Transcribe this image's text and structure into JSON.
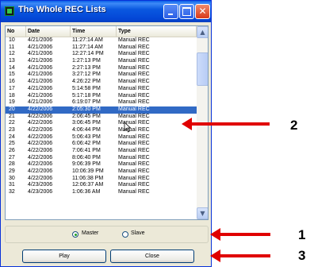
{
  "window": {
    "title": "The Whole REC Lists"
  },
  "list": {
    "headers": [
      "No",
      "Date",
      "Time",
      "Type"
    ],
    "rows": [
      [
        "10",
        "4/21/2006",
        "11:27:14 AM",
        "Manual REC"
      ],
      [
        "11",
        "4/21/2006",
        "11:27:14 AM",
        "Manual REC"
      ],
      [
        "12",
        "4/21/2006",
        "12:27:14 PM",
        "Manual REC"
      ],
      [
        "13",
        "4/21/2006",
        "1:27:13 PM",
        "Manual REC"
      ],
      [
        "14",
        "4/21/2006",
        "2:27:13 PM",
        "Manual REC"
      ],
      [
        "15",
        "4/21/2006",
        "3:27:12 PM",
        "Manual REC"
      ],
      [
        "16",
        "4/21/2006",
        "4:26:22 PM",
        "Manual REC"
      ],
      [
        "17",
        "4/21/2006",
        "5:14:58 PM",
        "Manual REC"
      ],
      [
        "18",
        "4/21/2006",
        "5:17:18 PM",
        "Manual REC"
      ],
      [
        "19",
        "4/21/2006",
        "6:19:07 PM",
        "Manual REC"
      ],
      [
        "20",
        "4/22/2006",
        "2:05:30 PM",
        "Manual REC"
      ],
      [
        "21",
        "4/22/2006",
        "2:06:45 PM",
        "Manual REC"
      ],
      [
        "22",
        "4/22/2006",
        "3:06:45 PM",
        "Manual REC"
      ],
      [
        "23",
        "4/22/2006",
        "4:06:44 PM",
        "Manual REC"
      ],
      [
        "24",
        "4/22/2006",
        "5:06:43 PM",
        "Manual REC"
      ],
      [
        "25",
        "4/22/2006",
        "6:06:42 PM",
        "Manual REC"
      ],
      [
        "26",
        "4/22/2006",
        "7:06:41 PM",
        "Manual REC"
      ],
      [
        "27",
        "4/22/2006",
        "8:06:40 PM",
        "Manual REC"
      ],
      [
        "28",
        "4/22/2006",
        "9:06:39 PM",
        "Manual REC"
      ],
      [
        "29",
        "4/22/2006",
        "10:06:39 PM",
        "Manual REC"
      ],
      [
        "30",
        "4/22/2006",
        "11:06:38 PM",
        "Manual REC"
      ],
      [
        "31",
        "4/23/2006",
        "12:06:37 AM",
        "Manual REC"
      ],
      [
        "32",
        "4/23/2006",
        "1:06:36 AM",
        "Manual REC"
      ]
    ],
    "selected_row_no": "20"
  },
  "mode": {
    "master_label": "Master",
    "slave_label": "Slave",
    "selected": "Master"
  },
  "buttons": {
    "play_label": "Play",
    "close_label": "Close"
  },
  "callouts": {
    "one": "1",
    "two": "2",
    "three": "3",
    "color": "#e00000"
  },
  "colors": {
    "titlebar": "#0346d6",
    "selection": "#316ac5",
    "window_bg": "#ece9d8"
  }
}
